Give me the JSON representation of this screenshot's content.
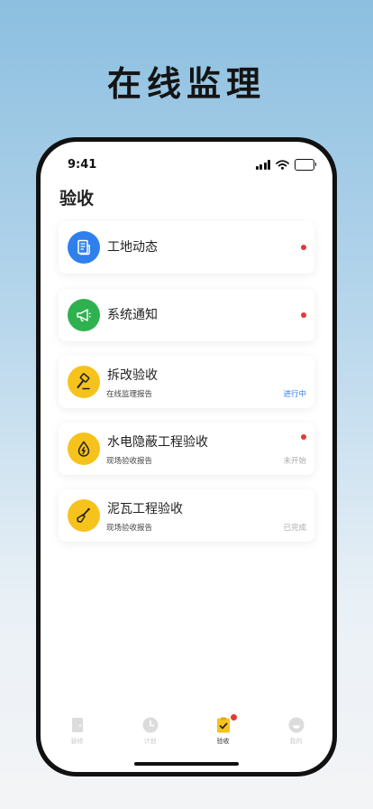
{
  "headline": "在线监理",
  "status_bar": {
    "time": "9:41"
  },
  "page": {
    "title": "验收"
  },
  "cards": [
    {
      "title": "工地动态",
      "subtitle": "",
      "status": "",
      "unread": true,
      "icon": "document-icon",
      "icon_color": "#2f80ed"
    },
    {
      "title": "系统通知",
      "subtitle": "",
      "status": "",
      "unread": true,
      "icon": "megaphone-icon",
      "icon_color": "#2eb24f"
    },
    {
      "title": "拆改验收",
      "subtitle": "在线监理报告",
      "status": "进行中",
      "unread": false,
      "icon": "hammer-icon",
      "icon_color": "#f6c21c",
      "status_color": "#2f80ed"
    },
    {
      "title": "水电隐蔽工程验收",
      "subtitle": "现场验收报告",
      "status": "未开始",
      "unread": true,
      "icon": "bolt-drop-icon",
      "icon_color": "#f6c21c",
      "status_color": "#aaaaaa"
    },
    {
      "title": "泥瓦工程验收",
      "subtitle": "现场验收报告",
      "status": "已完成",
      "unread": false,
      "icon": "trowel-icon",
      "icon_color": "#f6c21c",
      "status_color": "#aaaaaa"
    }
  ],
  "tabbar": {
    "items": [
      {
        "label": "装修",
        "icon": "door-icon",
        "active": false
      },
      {
        "label": "计划",
        "icon": "clock-icon",
        "active": false
      },
      {
        "label": "验收",
        "icon": "checklist-icon",
        "active": true,
        "badge": true
      },
      {
        "label": "我的",
        "icon": "smiley-icon",
        "active": false
      }
    ]
  }
}
